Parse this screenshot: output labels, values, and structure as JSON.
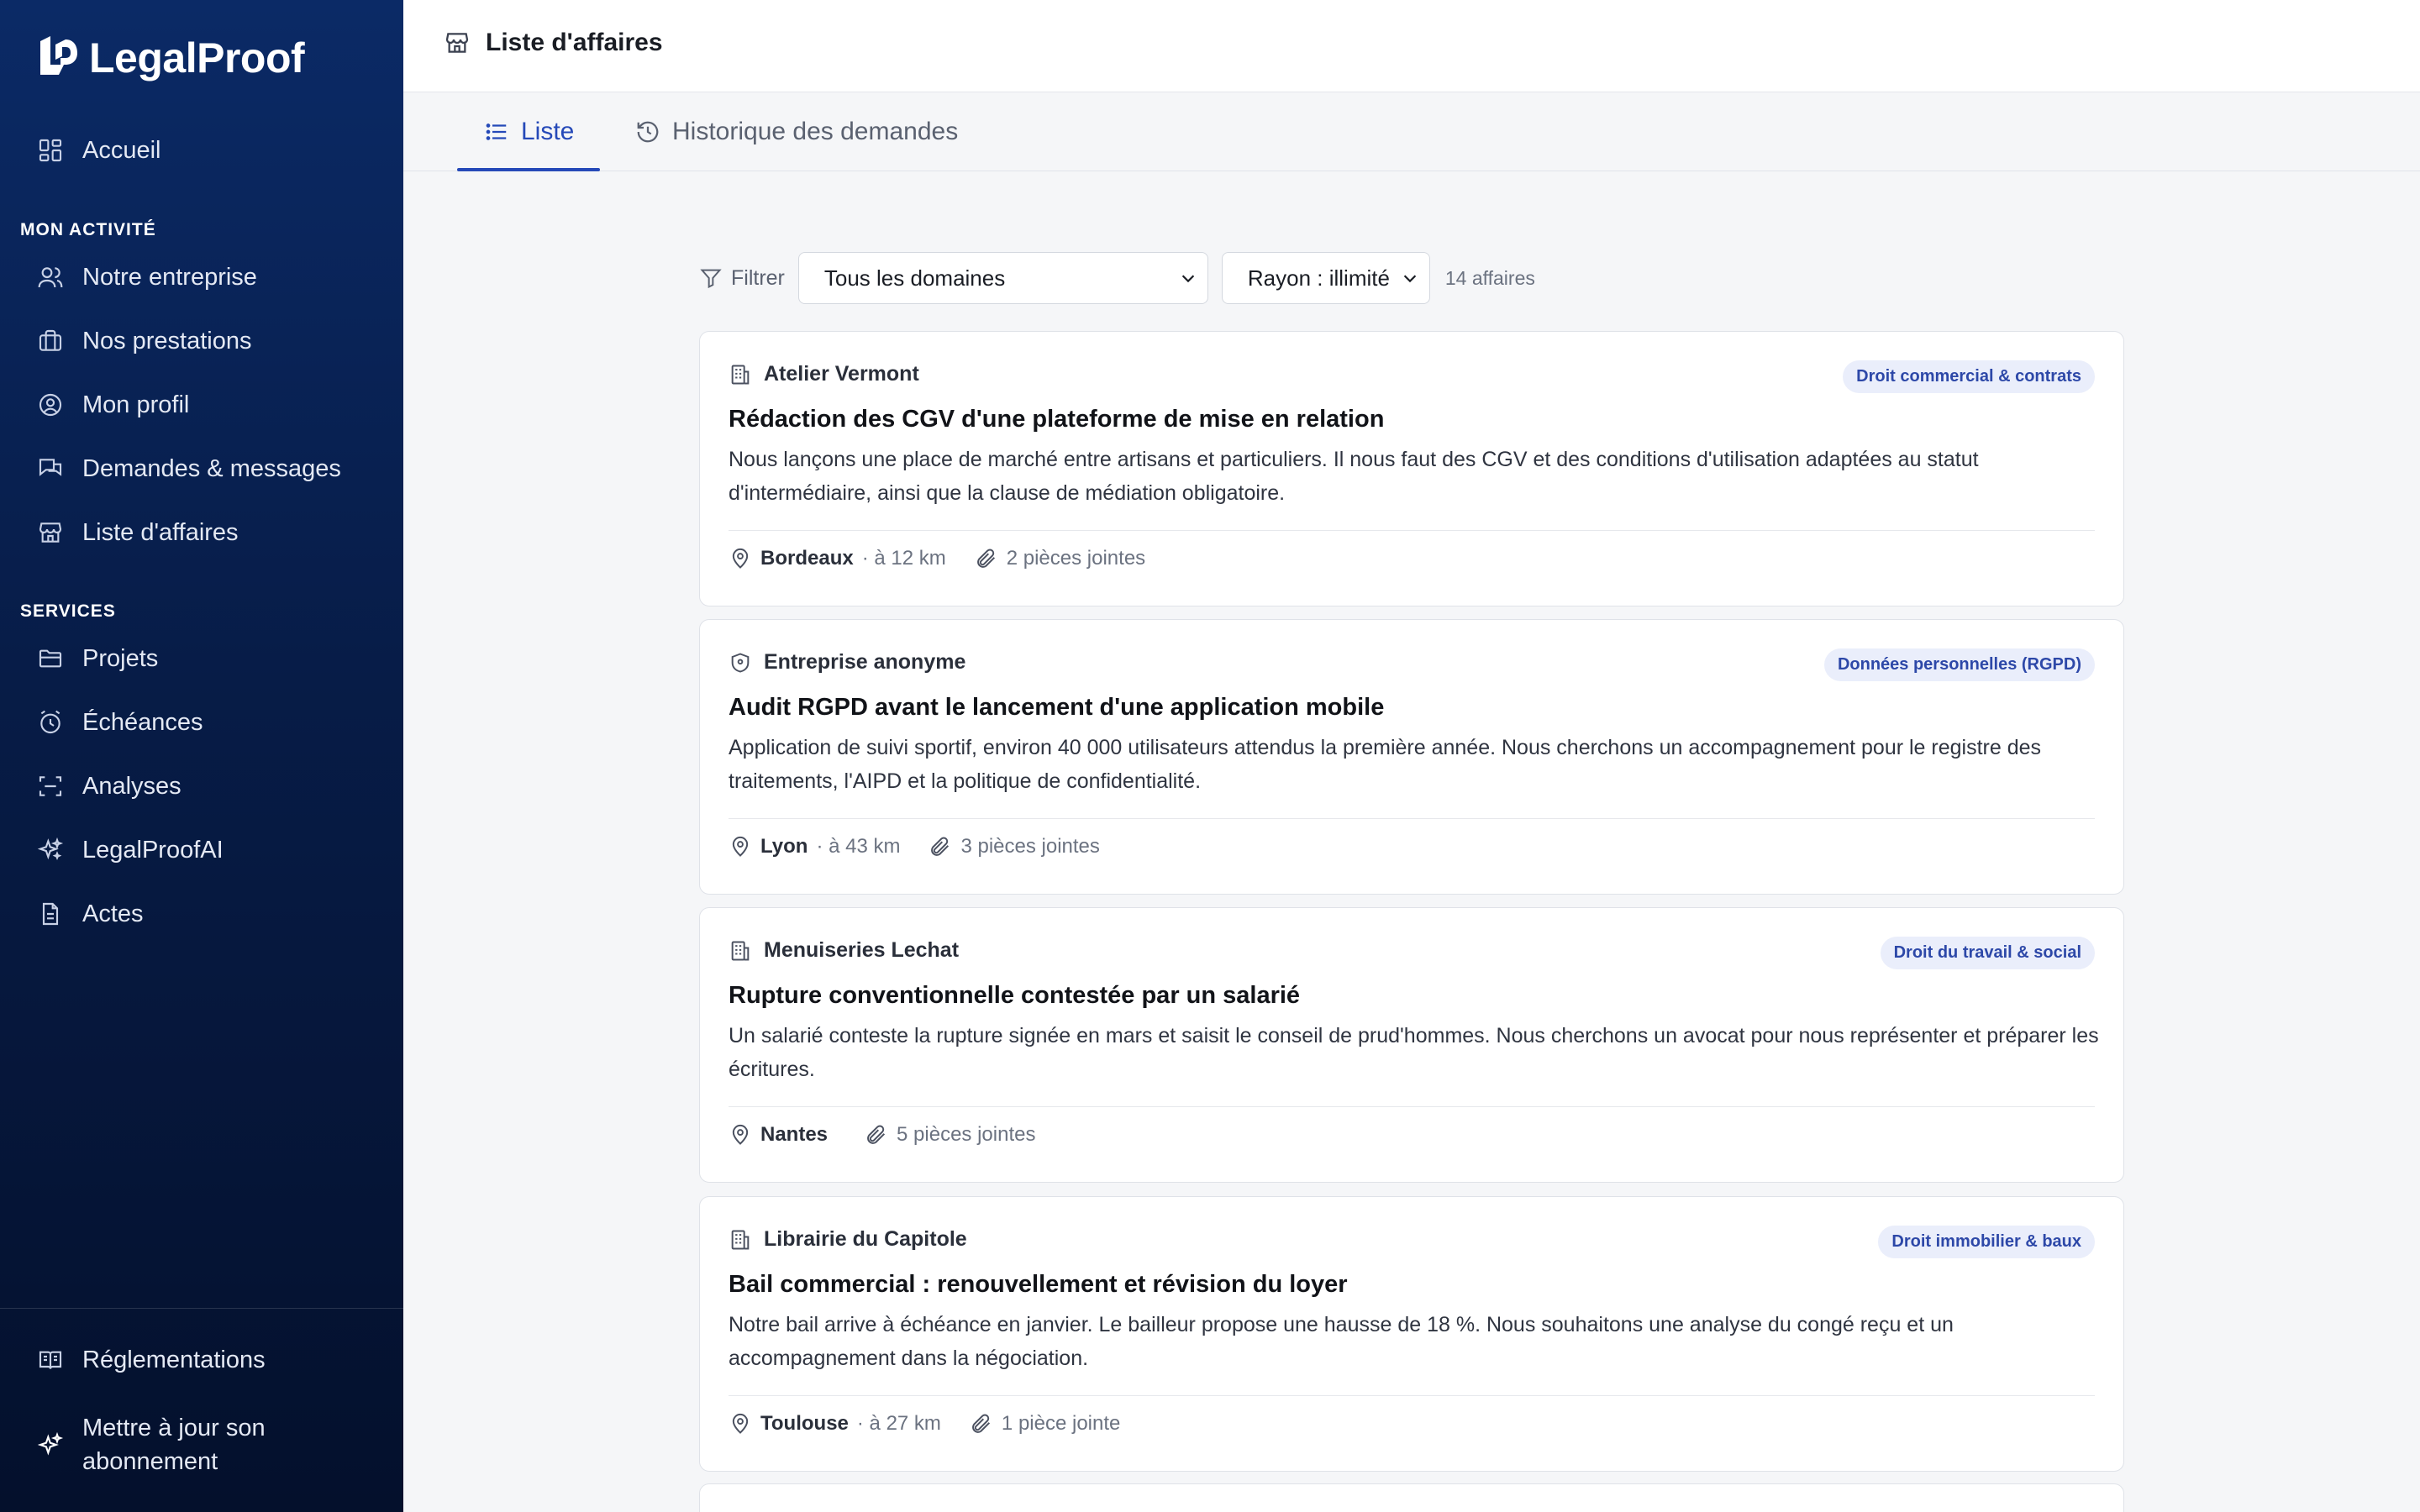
{
  "app": {
    "brand": "LegalProof"
  },
  "sidebar": {
    "home": "Accueil",
    "section_activity": "MON ACTIVITÉ",
    "activity_items": [
      {
        "label": "Notre entreprise",
        "icon": "users-icon"
      },
      {
        "label": "Nos prestations",
        "icon": "briefcase-icon"
      },
      {
        "label": "Mon profil",
        "icon": "user-circle-icon"
      },
      {
        "label": "Demandes & messages",
        "icon": "messages-icon"
      },
      {
        "label": "Liste d'affaires",
        "icon": "store-icon"
      }
    ],
    "section_services": "SERVICES",
    "service_items": [
      {
        "label": "Projets",
        "icon": "folder-icon"
      },
      {
        "label": "Échéances",
        "icon": "alarm-icon"
      },
      {
        "label": "Analyses",
        "icon": "scan-icon"
      },
      {
        "label": "LegalProofAI",
        "icon": "sparkles-icon"
      },
      {
        "label": "Actes",
        "icon": "document-icon"
      }
    ],
    "bottom_items": [
      {
        "label": "Réglementations",
        "icon": "book-icon"
      },
      {
        "label": "Mettre à jour son abonnement",
        "icon": "sparkle-icon"
      }
    ]
  },
  "header": {
    "title": "Liste d'affaires"
  },
  "tabs": [
    {
      "label": "Liste",
      "active": true
    },
    {
      "label": "Historique des demandes",
      "active": false
    }
  ],
  "filters": {
    "label": "Filtrer",
    "domain_select": "Tous les domaines",
    "radius_select": "Rayon : illimité",
    "count": "14 affaires"
  },
  "colors": {
    "accent": "#2549b8",
    "sidebar_top": "#0b2a66",
    "sidebar_bottom": "#04102c",
    "badge_bg": "#eaeefb"
  },
  "cards": [
    {
      "company": "Atelier Vermont",
      "company_icon": "building-icon",
      "badge": "Droit commercial & contrats",
      "title": "Rédaction des CGV d'une plateforme de mise en relation",
      "description": "Nous lançons une place de marché entre artisans et particuliers. Il nous faut des CGV et des conditions d'utilisation adaptées au statut d'intermédiaire, ainsi que la clause de médiation obligatoire.",
      "city": "Bordeaux",
      "distance": "· à 12 km",
      "attachments": "2 pièces jointes"
    },
    {
      "company": "Entreprise anonyme",
      "company_icon": "shield-icon",
      "badge": "Données personnelles (RGPD)",
      "title": "Audit RGPD avant le lancement d'une application mobile",
      "description": "Application de suivi sportif, environ 40 000 utilisateurs attendus la première année. Nous cherchons un accompagnement pour le registre des traitements, l'AIPD et la politique de confidentialité.",
      "city": "Lyon",
      "distance": "· à 43 km",
      "attachments": "3 pièces jointes"
    },
    {
      "company": "Menuiseries Lechat",
      "company_icon": "building-icon",
      "badge": "Droit du travail & social",
      "title": "Rupture conventionnelle contestée par un salarié",
      "description": "Un salarié conteste la rupture signée en mars et saisit le conseil de prud'hommes. Nous cherchons un avocat pour nous représenter et préparer les écritures.",
      "city": "Nantes",
      "distance": "",
      "attachments": "5 pièces jointes"
    },
    {
      "company": "Librairie du Capitole",
      "company_icon": "building-icon",
      "badge": "Droit immobilier & baux",
      "title": "Bail commercial : renouvellement et révision du loyer",
      "description": "Notre bail arrive à échéance en janvier. Le bailleur propose une hausse de 18 %. Nous souhaitons une analyse du congé reçu et un accompagnement dans la négociation.",
      "city": "Toulouse",
      "distance": "· à 27 km",
      "attachments": "1 pièce jointe"
    }
  ]
}
